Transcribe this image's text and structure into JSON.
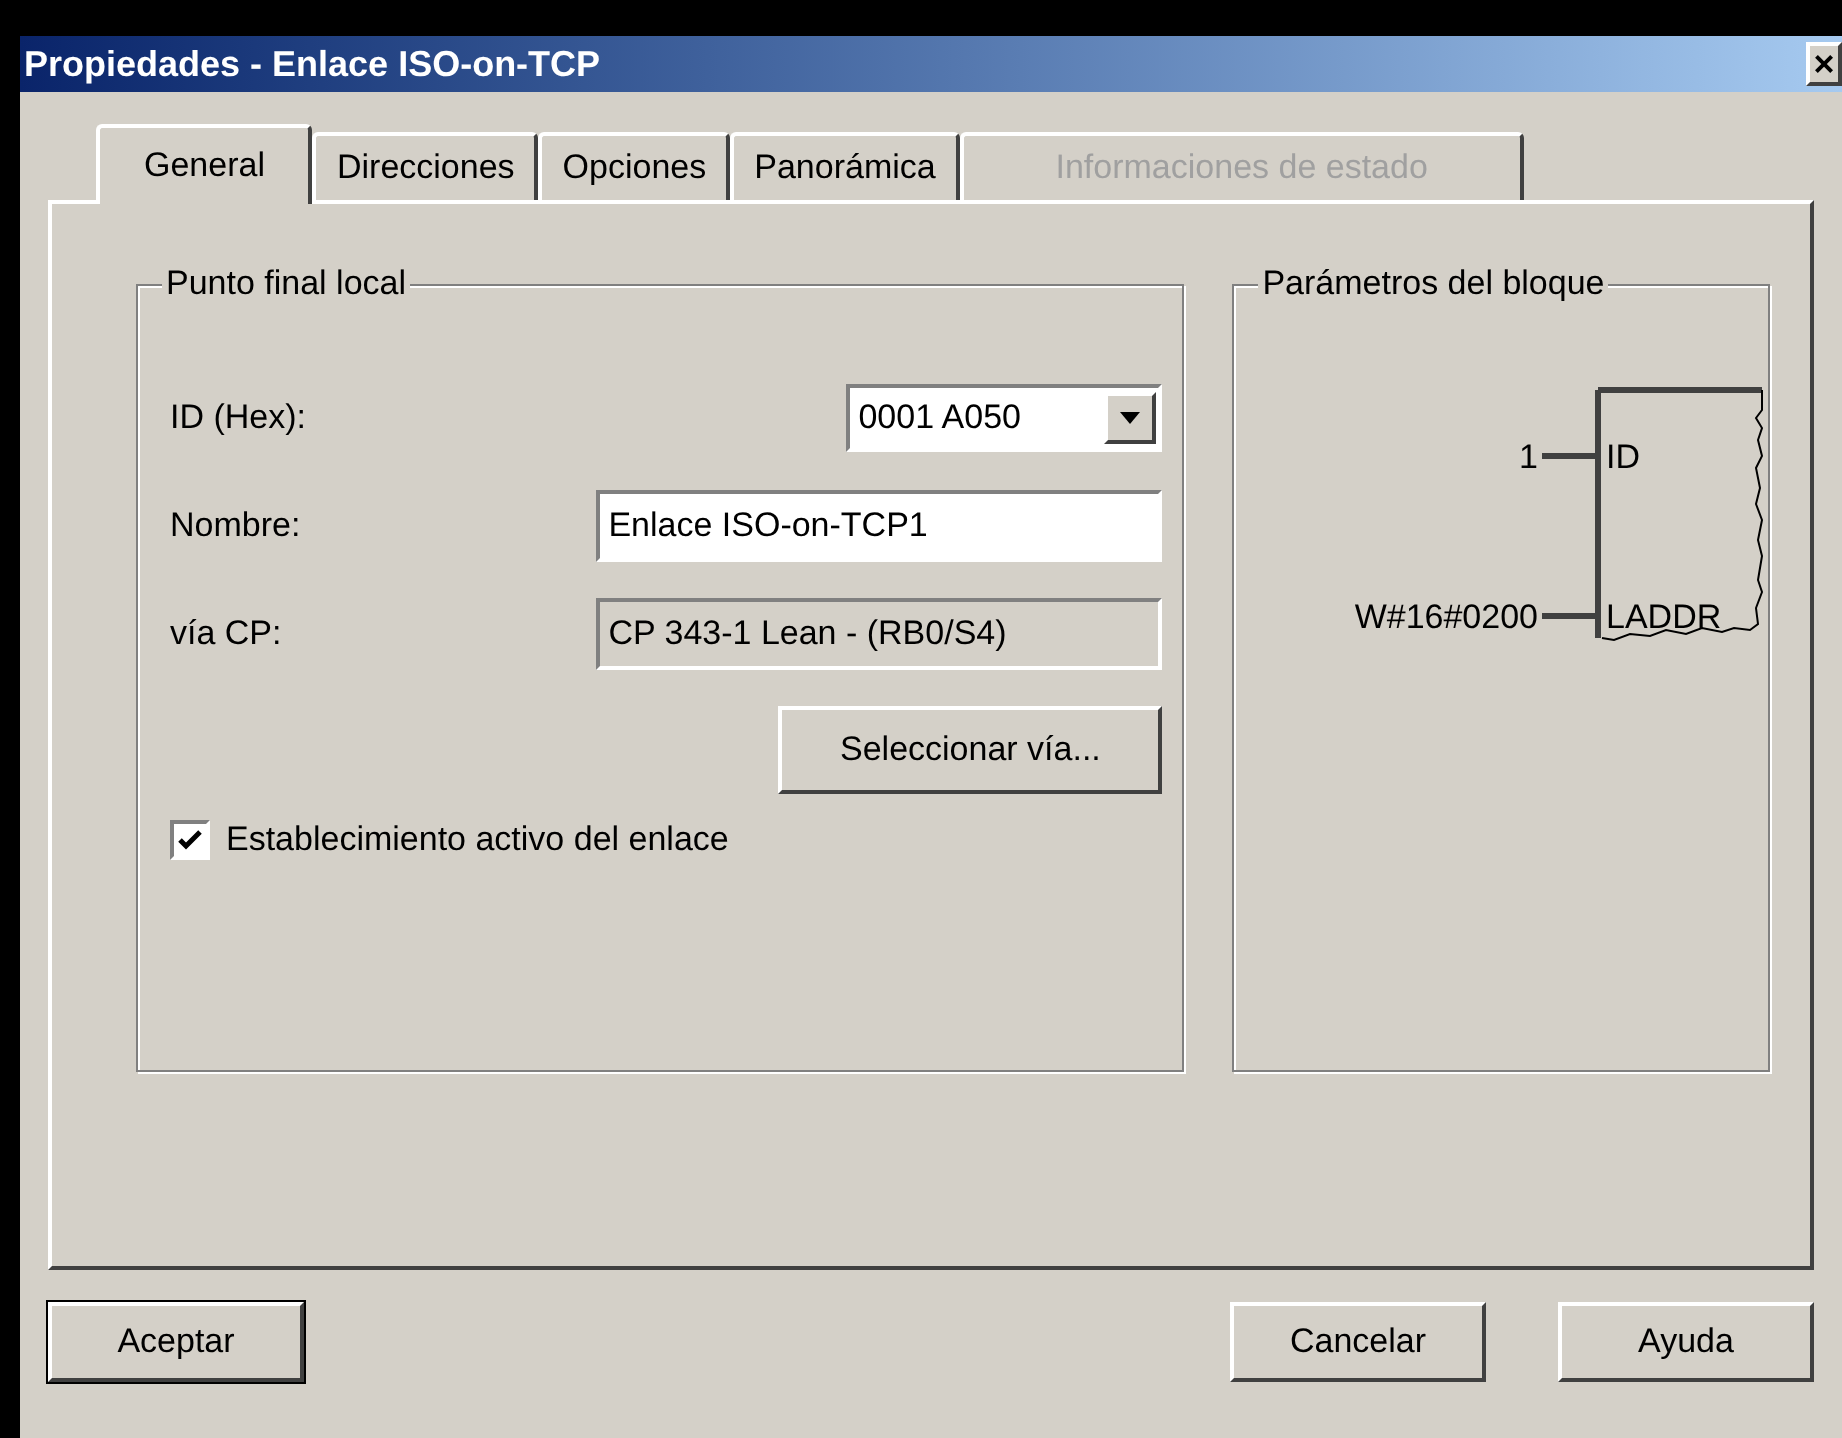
{
  "window": {
    "title": "Propiedades - Enlace ISO-on-TCP",
    "close": "×"
  },
  "tabs": [
    {
      "label": "General",
      "selected": true,
      "disabled": false
    },
    {
      "label": "Direcciones",
      "selected": false,
      "disabled": false
    },
    {
      "label": "Opciones",
      "selected": false,
      "disabled": false
    },
    {
      "label": "Panorámica",
      "selected": false,
      "disabled": false
    },
    {
      "label": "Informaciones de estado",
      "selected": false,
      "disabled": true
    }
  ],
  "local_endpoint": {
    "title": "Punto final local",
    "fields": [
      {
        "kind": "dropdown",
        "label": "ID (Hex):",
        "value": "0001 A050"
      },
      {
        "kind": "text",
        "label": "Nombre:",
        "value": "Enlace ISO-on-TCP1"
      },
      {
        "kind": "readonly",
        "label": "vía CP:",
        "value": "CP 343-1 Lean - (RB0/S4)"
      }
    ],
    "select_button": "Seleccionar vía...",
    "active_connection": {
      "label": "Establecimiento activo del enlace",
      "checked": true
    }
  },
  "block_parameters": {
    "title": "Parámetros del bloque",
    "pins": [
      {
        "value": "1",
        "name": "ID"
      },
      {
        "value": "W#16#0200",
        "name": "LADDR"
      }
    ]
  },
  "buttons": [
    "Aceptar",
    "Cancelar",
    "Ayuda"
  ]
}
